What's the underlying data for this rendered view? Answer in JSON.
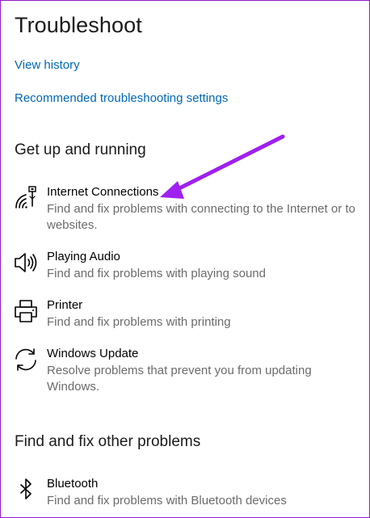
{
  "page": {
    "title": "Troubleshoot",
    "links": {
      "view_history": "View history",
      "recommended_settings": "Recommended troubleshooting settings"
    }
  },
  "sections": {
    "get_up_and_running": {
      "heading": "Get up and running",
      "items": [
        {
          "icon": "wifi-icon",
          "name": "Internet Connections",
          "description": "Find and fix problems with connecting to the Internet or to websites."
        },
        {
          "icon": "speaker-icon",
          "name": "Playing Audio",
          "description": "Find and fix problems with playing sound"
        },
        {
          "icon": "printer-icon",
          "name": "Printer",
          "description": "Find and fix problems with printing"
        },
        {
          "icon": "sync-icon",
          "name": "Windows Update",
          "description": "Resolve problems that prevent you from updating Windows."
        }
      ]
    },
    "other_problems": {
      "heading": "Find and fix other problems",
      "items": [
        {
          "icon": "bluetooth-icon",
          "name": "Bluetooth",
          "description": "Find and fix problems with Bluetooth devices"
        }
      ]
    }
  },
  "colors": {
    "link": "#0067b8",
    "description": "#6b6b6b",
    "annotation_arrow": "#a020f0",
    "border": "#8f1cc2"
  }
}
